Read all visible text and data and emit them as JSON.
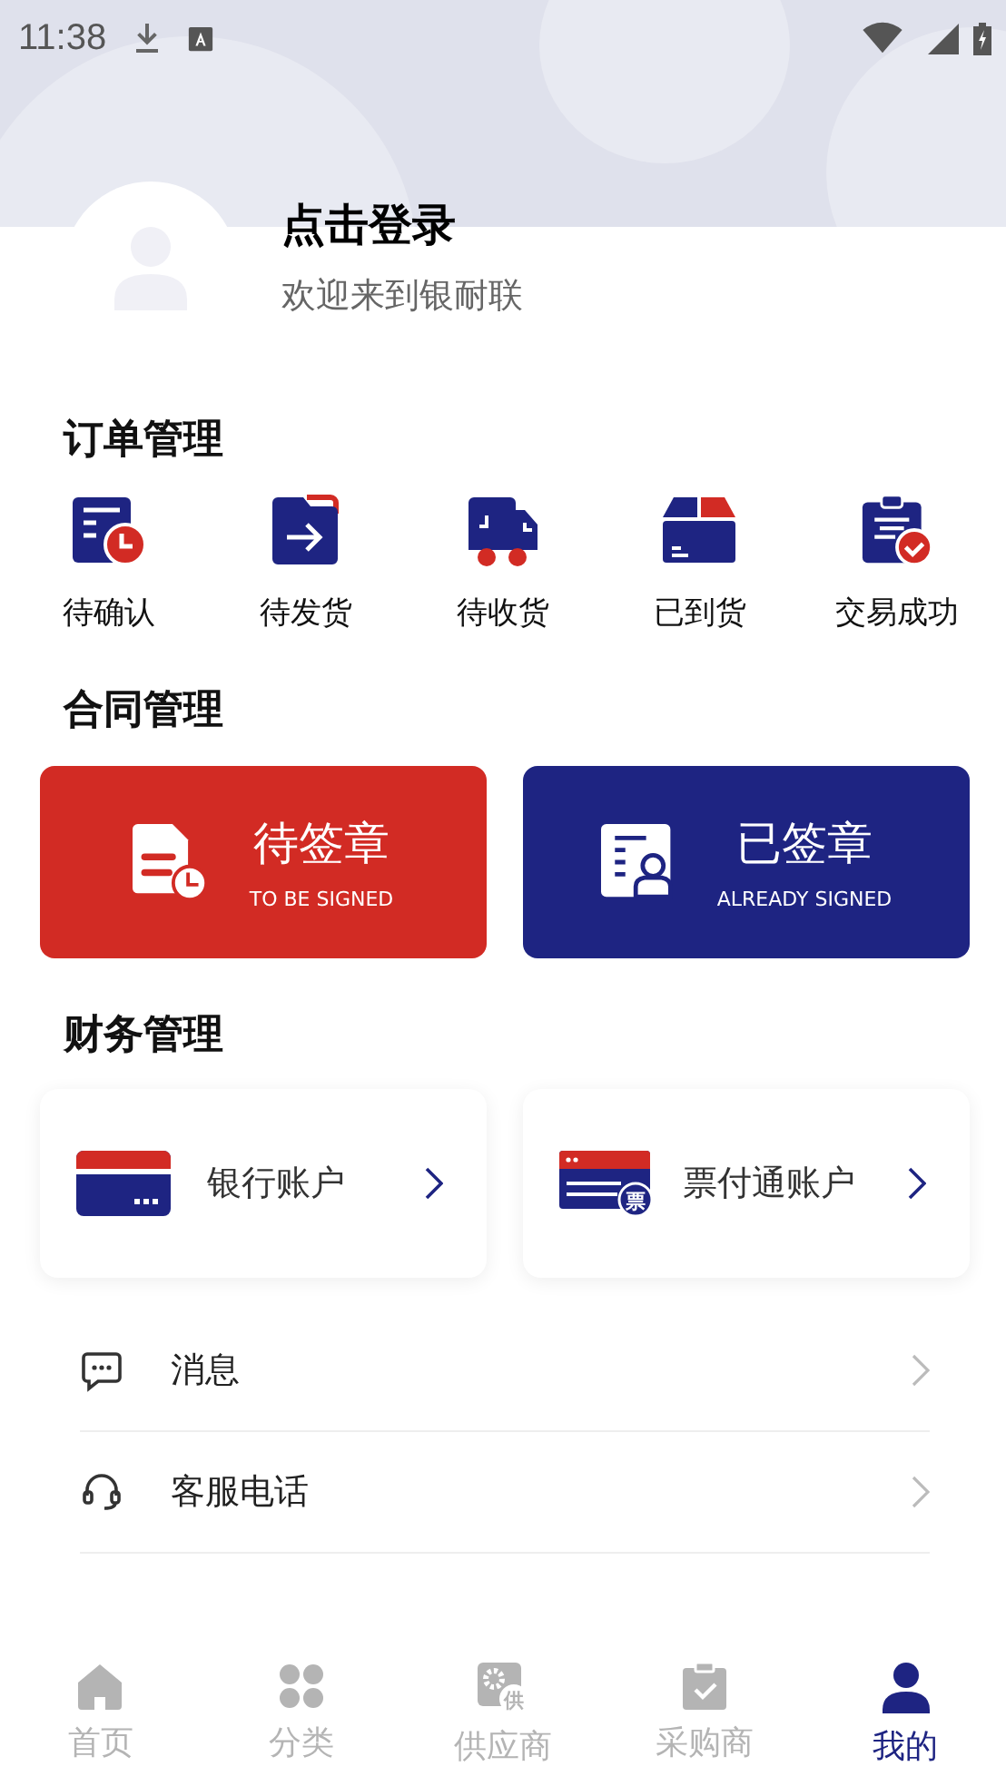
{
  "status_bar": {
    "time": "11:38"
  },
  "profile": {
    "title": "点击登录",
    "subtitle": "欢迎来到银耐联"
  },
  "orders": {
    "title": "订单管理",
    "items": [
      {
        "kind": "confirm",
        "label": "待确认"
      },
      {
        "kind": "ship",
        "label": "待发货"
      },
      {
        "kind": "receive",
        "label": "待收货"
      },
      {
        "kind": "arrived",
        "label": "已到货"
      },
      {
        "kind": "done",
        "label": "交易成功"
      }
    ]
  },
  "contracts": {
    "title": "合同管理",
    "cards": [
      {
        "kind": "pending",
        "title": "待签章",
        "subtitle": "TO BE SIGNED",
        "color": "#d22b24"
      },
      {
        "kind": "signed",
        "title": "已签章",
        "subtitle": "ALREADY SIGNED",
        "color": "#1e2482"
      }
    ]
  },
  "finance": {
    "title": "财务管理",
    "cards": [
      {
        "kind": "bank",
        "label": "银行账户"
      },
      {
        "kind": "bill",
        "label": "票付通账户",
        "icon_text": "票"
      }
    ]
  },
  "menu": [
    {
      "kind": "message",
      "label": "消息"
    },
    {
      "kind": "service",
      "label": "客服电话"
    }
  ],
  "tab_bar": [
    {
      "kind": "home",
      "label": "首页",
      "selected": false
    },
    {
      "kind": "category",
      "label": "分类",
      "selected": false
    },
    {
      "kind": "supplier",
      "label": "供应商",
      "selected": false,
      "icon_text": "供"
    },
    {
      "kind": "buyer",
      "label": "采购商",
      "selected": false
    },
    {
      "kind": "mine",
      "label": "我的",
      "selected": true
    }
  ]
}
